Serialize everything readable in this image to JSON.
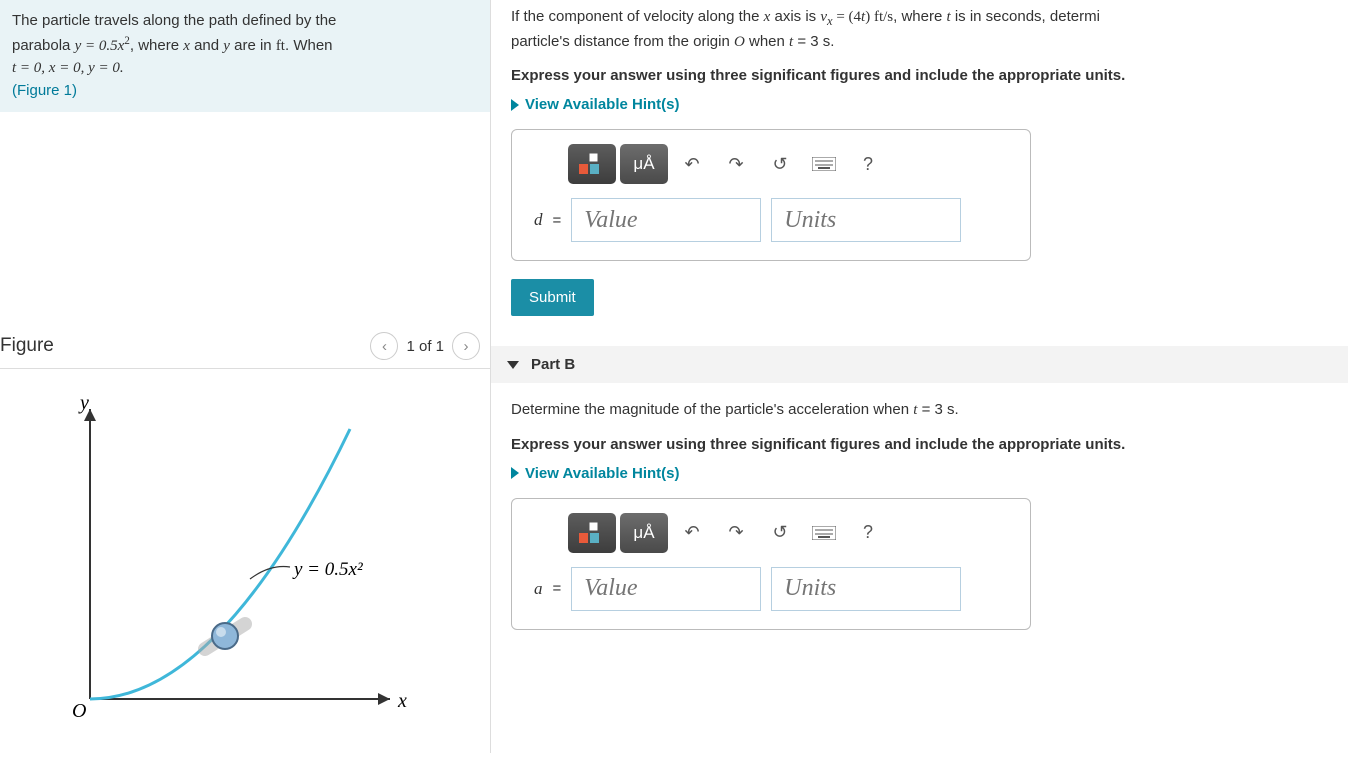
{
  "intro": {
    "line1_a": "The particle travels along the path defined by the",
    "line2_a": "parabola ",
    "eq1": "y = 0.5x",
    "eq1_sup": "2",
    "line2_b": ", where ",
    "var_x": "x",
    "line2_c": " and ",
    "var_y": "y",
    "line2_d": " are in ",
    "unit_ft": "ft",
    "line2_e": ". When",
    "line3": "t = 0, x = 0, y = 0.",
    "fig_link": "(Figure 1)"
  },
  "figure": {
    "title": "Figure",
    "pager": "1 of 1",
    "y_label": "y",
    "x_label": "x",
    "O_label": "O",
    "curve_label": "y = 0.5x²"
  },
  "partA": {
    "q_a": "If the component of velocity along the ",
    "var_x": "x",
    "q_b": " axis is ",
    "vx": "v",
    "vx_sub": "x",
    "q_c": " = (4",
    "var_t": "t",
    "q_d": ")  ft/s",
    "q_e": ", where ",
    "q_f": " is in seconds, determi",
    "q_g": "particle's distance from the origin ",
    "var_O": "O",
    "q_h": " when ",
    "q_i": " = 3 s.",
    "instruction": "Express your answer using three significant figures and include the appropriate units.",
    "hints": "View Available Hint(s)",
    "var_label": "d",
    "eq": "=",
    "value_ph": "Value",
    "units_ph": "Units",
    "submit": "Submit",
    "micro": "μÅ",
    "help": "?"
  },
  "partB": {
    "header": "Part B",
    "q_a": "Determine the magnitude of the particle's acceleration when ",
    "var_t": "t",
    "q_b": " = 3 s.",
    "instruction": "Express your answer using three significant figures and include the appropriate units.",
    "hints": "View Available Hint(s)",
    "var_label": "a",
    "eq": "=",
    "value_ph": "Value",
    "units_ph": "Units",
    "micro": "μÅ",
    "help": "?"
  }
}
